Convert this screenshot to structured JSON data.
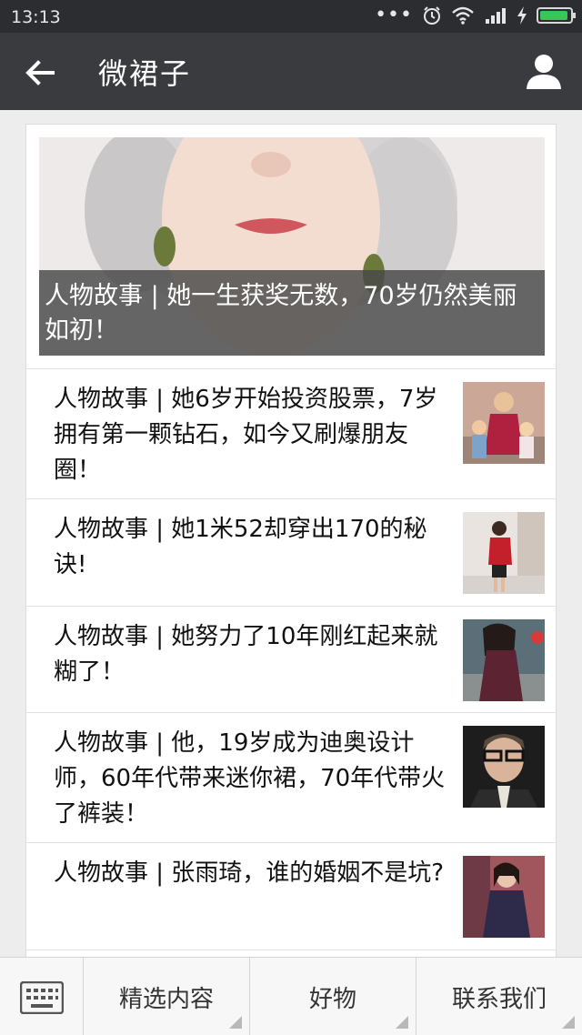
{
  "status_bar": {
    "time": "13:13"
  },
  "header": {
    "title": "微裙子",
    "back_icon": "back-arrow-icon",
    "user_icon": "user-icon"
  },
  "hero": {
    "caption": "人物故事 | 她一生获奖无数，70岁仍然美丽如初！"
  },
  "articles": [
    {
      "title": "人物故事 | 她6岁开始投资股票，7岁拥有第一颗钻石，如今又刷爆朋友圈！"
    },
    {
      "title": "人物故事 | 她1米52却穿出170的秘诀!"
    },
    {
      "title": "人物故事 | 她努力了10年刚红起来就糊了！"
    },
    {
      "title": "人物故事 | 他，19岁成为迪奥设计师，60年代带来迷你裙，70年代带火了裤装！"
    },
    {
      "title": "人物故事 | 张雨琦，谁的婚姻不是坑?"
    }
  ],
  "menu": {
    "keyboard_icon": "keyboard-icon",
    "items": [
      {
        "label": "精选内容"
      },
      {
        "label": "好物"
      },
      {
        "label": "联系我们"
      }
    ]
  },
  "colors": {
    "header_bg": "#3a3b3f",
    "status_bg": "#2c2d30",
    "page_bg": "#ededed"
  }
}
